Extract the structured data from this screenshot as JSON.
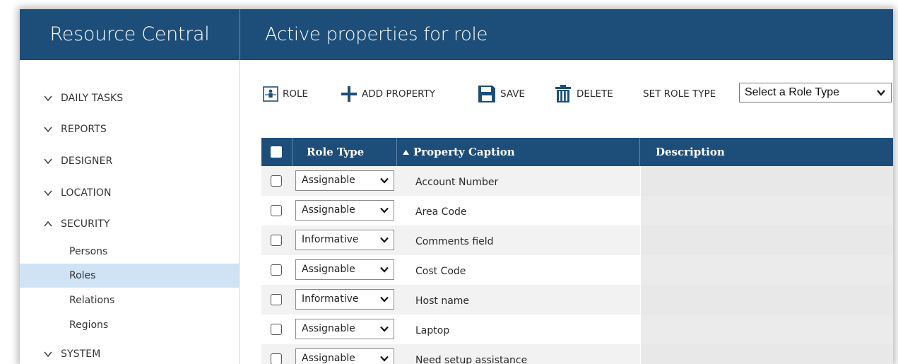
{
  "header": {
    "app_title": "Resource Central",
    "page_title": "Active properties for role"
  },
  "sidebar": {
    "items": [
      {
        "label": "DAILY TASKS",
        "expanded": false,
        "icon": "chevron-down-icon"
      },
      {
        "label": "REPORTS",
        "expanded": false,
        "icon": "chevron-down-icon"
      },
      {
        "label": "DESIGNER",
        "expanded": false,
        "icon": "chevron-down-icon"
      },
      {
        "label": "LOCATION",
        "expanded": false,
        "icon": "chevron-down-icon"
      },
      {
        "label": "SECURITY",
        "expanded": true,
        "icon": "chevron-up-icon"
      },
      {
        "label": "SYSTEM",
        "expanded": false,
        "icon": "chevron-down-icon"
      }
    ],
    "security_subitems": [
      {
        "label": "Persons",
        "active": false
      },
      {
        "label": "Roles",
        "active": true
      },
      {
        "label": "Relations",
        "active": false
      },
      {
        "label": "Regions",
        "active": false
      }
    ]
  },
  "toolbar": {
    "role_label": "ROLE",
    "add_property_label": "ADD PROPERTY",
    "save_label": "SAVE",
    "delete_label": "DELETE",
    "set_role_type_label": "SET ROLE TYPE",
    "role_type_select_value": "Select a Role Type"
  },
  "table": {
    "columns": [
      "Role Type",
      "Property Caption",
      "Description"
    ],
    "sort_column": "Property Caption",
    "sort_direction": "ascending",
    "rows": [
      {
        "role_type": "Assignable",
        "caption": "Account Number",
        "description": ""
      },
      {
        "role_type": "Assignable",
        "caption": "Area Code",
        "description": ""
      },
      {
        "role_type": "Informative",
        "caption": "Comments field",
        "description": ""
      },
      {
        "role_type": "Assignable",
        "caption": "Cost Code",
        "description": ""
      },
      {
        "role_type": "Informative",
        "caption": "Host name",
        "description": ""
      },
      {
        "role_type": "Assignable",
        "caption": "Laptop",
        "description": ""
      },
      {
        "role_type": "Assignable",
        "caption": "Need setup assistance",
        "description": ""
      }
    ]
  },
  "colors": {
    "header_bg": "#1d4e79",
    "active_nav_bg": "#cfe3f4",
    "icon_blue": "#1d4e79"
  }
}
